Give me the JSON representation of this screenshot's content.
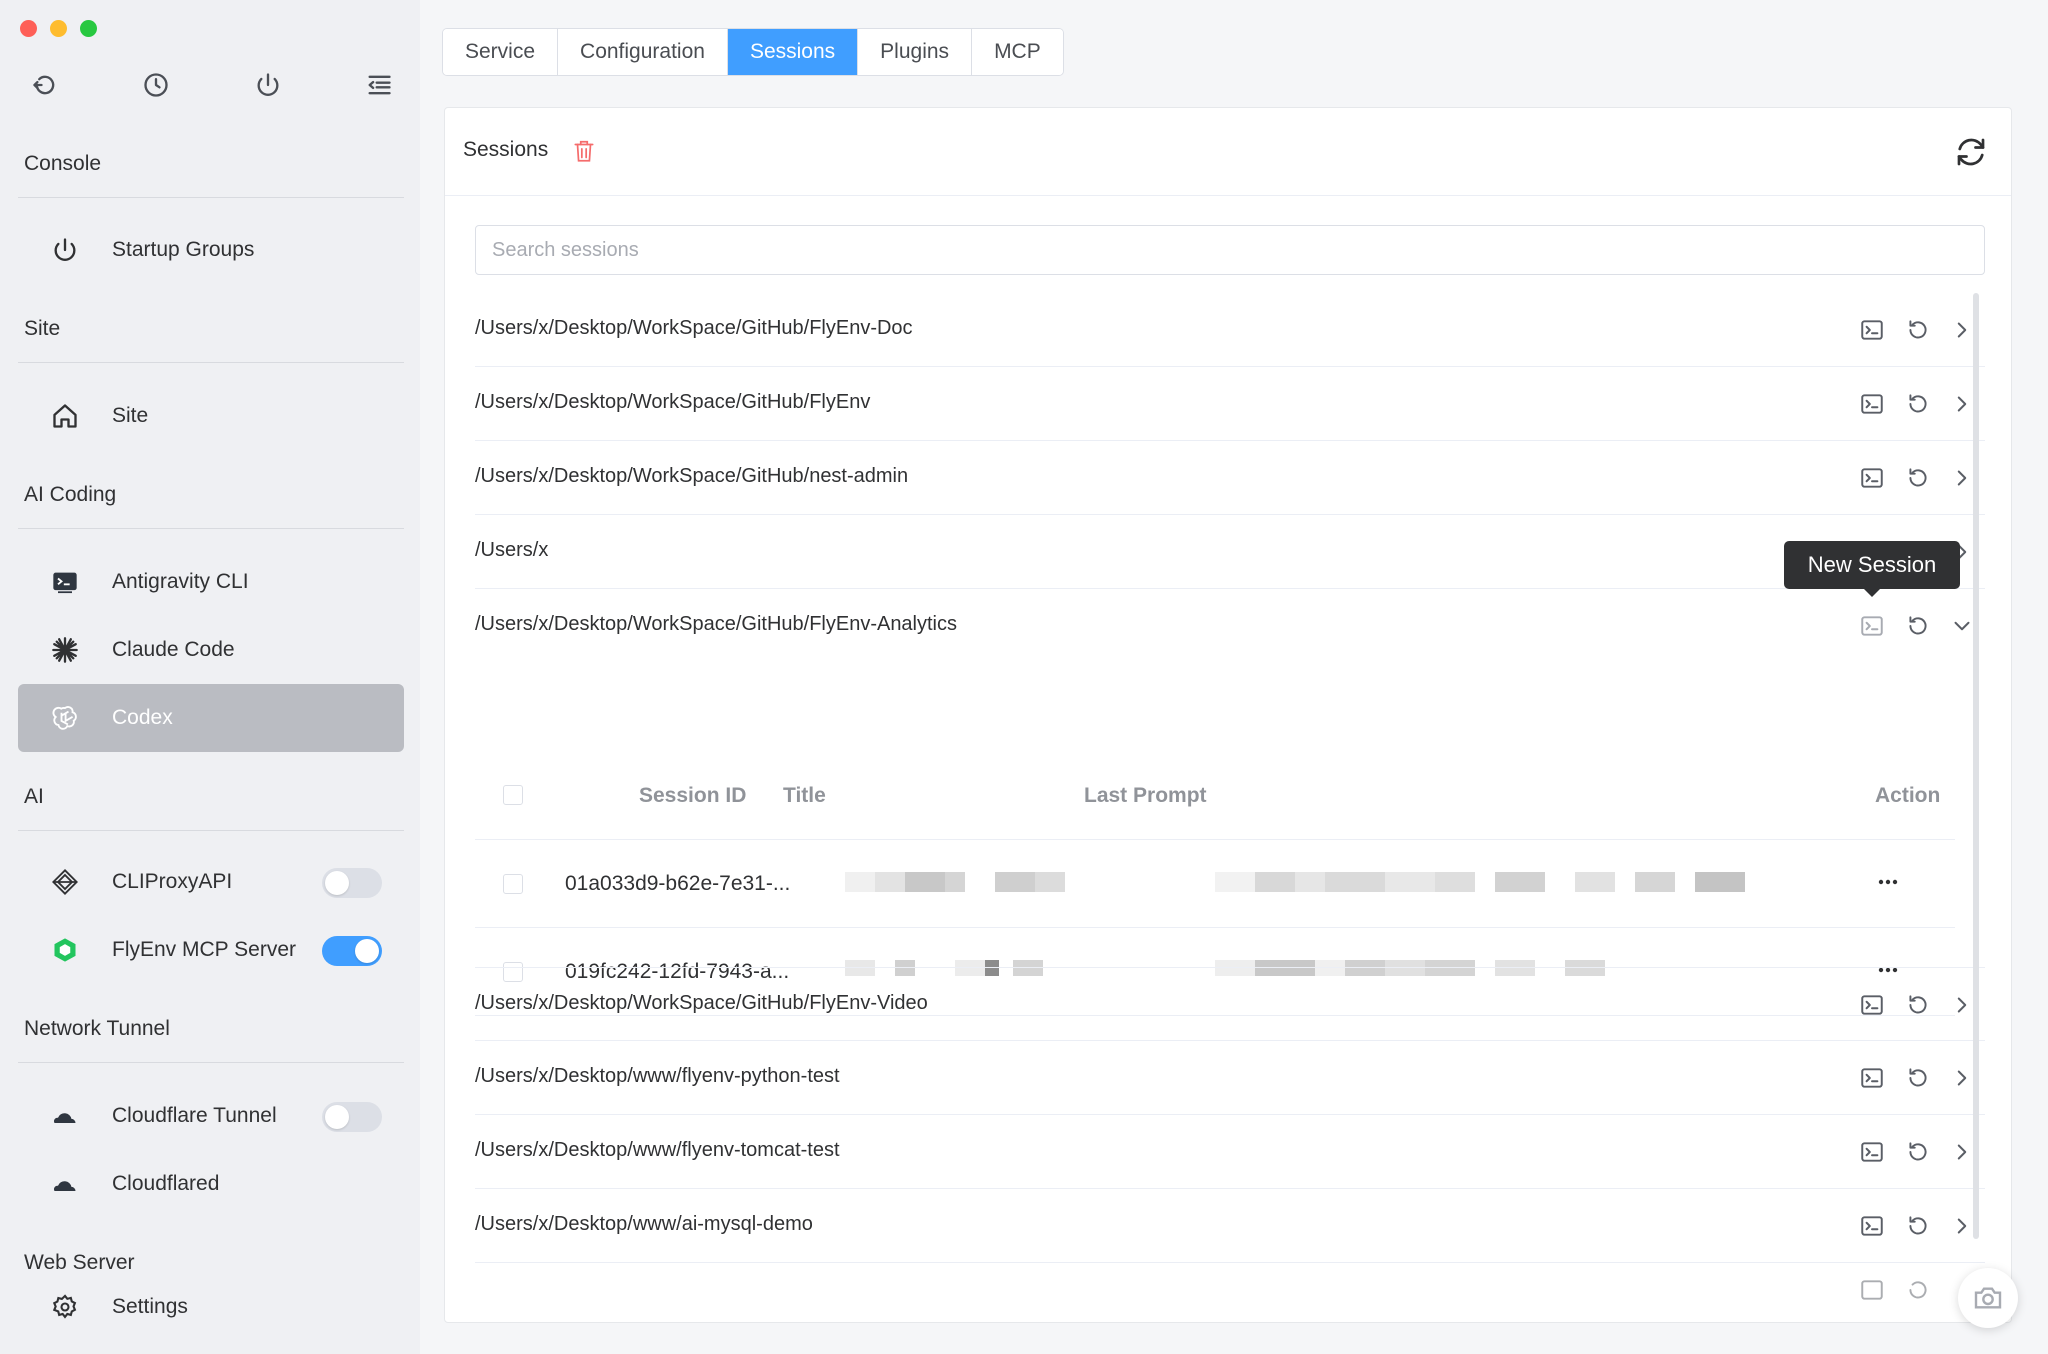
{
  "sidebar": {
    "top_icons": [
      "back-icon",
      "clock-icon",
      "power-icon",
      "menu-fold-icon"
    ],
    "groups": [
      {
        "title": "Console",
        "items": [
          {
            "label": "Startup Groups",
            "icon": "power-icon"
          }
        ]
      },
      {
        "title": "Site",
        "items": [
          {
            "label": "Site",
            "icon": "home-icon"
          }
        ]
      },
      {
        "title": "AI Coding",
        "items": [
          {
            "label": "Antigravity CLI",
            "icon": "terminal-icon"
          },
          {
            "label": "Claude Code",
            "icon": "claude-icon"
          },
          {
            "label": "Codex",
            "icon": "openai-icon",
            "active": true
          }
        ]
      },
      {
        "title": "AI",
        "items": [
          {
            "label": "CLIProxyAPI",
            "icon": "diamond-icon",
            "toggle": false
          },
          {
            "label": "FlyEnv MCP Server",
            "icon": "mcp-box-icon",
            "toggle": true
          }
        ]
      },
      {
        "title": "Network Tunnel",
        "items": [
          {
            "label": "Cloudflare Tunnel",
            "icon": "cloud-icon",
            "toggle": false
          },
          {
            "label": "Cloudflared",
            "icon": "cloud-icon"
          }
        ]
      },
      {
        "title": "Web Server",
        "items": [
          {
            "label": "Settings",
            "icon": "gear-icon"
          }
        ]
      }
    ]
  },
  "tabs": [
    {
      "label": "Service"
    },
    {
      "label": "Configuration"
    },
    {
      "label": "Sessions",
      "active": true
    },
    {
      "label": "Plugins"
    },
    {
      "label": "MCP"
    }
  ],
  "panel": {
    "title": "Sessions",
    "search_placeholder": "Search sessions"
  },
  "projects": [
    {
      "path": "/Users/x/Desktop/WorkSpace/GitHub/FlyEnv-Doc"
    },
    {
      "path": "/Users/x/Desktop/WorkSpace/GitHub/FlyEnv"
    },
    {
      "path": "/Users/x/Desktop/WorkSpace/GitHub/nest-admin"
    },
    {
      "path": "/Users/x"
    },
    {
      "path": "/Users/x/Desktop/WorkSpace/GitHub/FlyEnv-Analytics",
      "expanded": true
    },
    {
      "path": "/Users/x/Desktop/WorkSpace/GitHub/FlyEnv-Video"
    },
    {
      "path": "/Users/x/Desktop/www/flyenv-python-test"
    },
    {
      "path": "/Users/x/Desktop/www/flyenv-tomcat-test"
    },
    {
      "path": "/Users/x/Desktop/www/ai-mysql-demo"
    }
  ],
  "session_table": {
    "headers": {
      "session_id": "Session ID",
      "title": "Title",
      "last_prompt": "Last Prompt",
      "action": "Action"
    },
    "rows": [
      {
        "session_id": "01a033d9-b62e-7e31-..."
      },
      {
        "session_id": "019fc242-12fd-7943-a..."
      }
    ]
  },
  "tooltip": "New Session",
  "colors": {
    "accent": "#409eff",
    "active_nav": "#babcc2",
    "mcp_green": "#22c55e"
  }
}
